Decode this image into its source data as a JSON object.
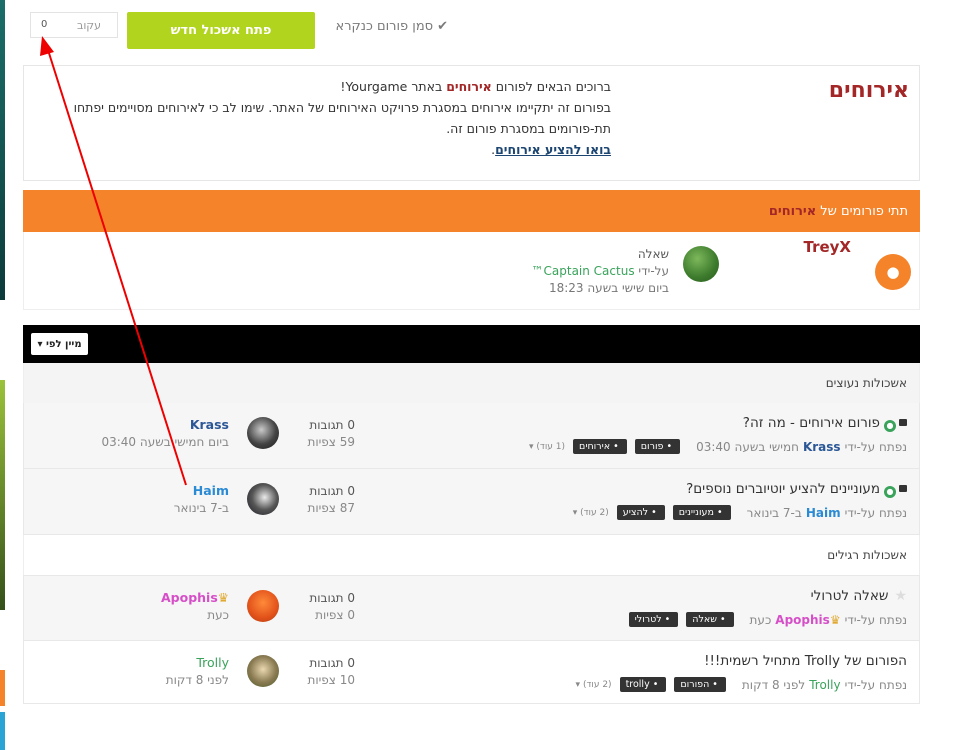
{
  "toolbar_top": {
    "follow_label": "עקוב",
    "follow_count": "0",
    "new_topic_label": "פתח אשכול חדש",
    "mark_read_label": "סמן פורום כנקרא"
  },
  "forum": {
    "title": "אירוחים",
    "welcome_prefix": "ברוכים הבאים לפורום",
    "welcome_name": "אירוחים",
    "welcome_suffix": "באתר Yourgame!",
    "description": "בפורום זה יתקיימו אירוחים במסגרת פרויקט האירוחים של האתר. שימו לב כי לאירוחים מסויימים יפתחו תת-פורומים במסגרת פורום זה.",
    "link_text": "בואו להציע אירוחים"
  },
  "subforums": {
    "header_prefix": "תתי פורומים של",
    "header_name": "אירוחים",
    "item": {
      "name": "TreyX",
      "last_topic": "שאלה",
      "by_prefix": "על-ידי",
      "last_user": "Captain Cactus™",
      "last_time": "ביום שישי בשעה 18:23"
    }
  },
  "list": {
    "sort_label": "מיין לפי"
  },
  "sections": {
    "pinned_label": "אשכולות נעוצים",
    "regular_label": "אשכולות רגילים"
  },
  "topics": [
    {
      "title": "פורום אירוחים - מה זה?",
      "meta_prefix": "נפתח על-ידי",
      "author": "Krass",
      "meta_time": "חמישי בשעה 03:40",
      "tags": [
        "פורום",
        "אירוחים"
      ],
      "more": "(1 עוד)",
      "replies": "0 תגובות",
      "views": "59 צפיות",
      "last_user": "Krass",
      "last_time": "ביום חמישי בשעה 03:40"
    },
    {
      "title": "מעוניינים להציע יוטיוברים נוספים?",
      "meta_prefix": "נפתח על-ידי",
      "author": "Haim",
      "meta_time": "ב-7 בינואר",
      "tags": [
        "מעוניינים",
        "להציע"
      ],
      "more": "(2 עוד)",
      "replies": "0 תגובות",
      "views": "87 צפיות",
      "last_user": "Haim",
      "last_time": "ב-7 בינואר"
    },
    {
      "title": "שאלה לטרולי",
      "meta_prefix": "נפתח על-ידי",
      "author": "Apophis",
      "meta_time": "כעת",
      "tags": [
        "שאלה",
        "לטרולי"
      ],
      "more": "",
      "replies": "0 תגובות",
      "views": "0 צפיות",
      "last_user": "Apophis",
      "last_time": "כעת"
    },
    {
      "title": "הפורום של Trolly מתחיל רשמית!!!",
      "meta_prefix": "נפתח על-ידי",
      "author": "Trolly",
      "meta_time": "לפני 8 דקות",
      "tags": [
        "הפורום",
        "trolly"
      ],
      "more": "(2 עוד)",
      "replies": "0 תגובות",
      "views": "10 צפיות",
      "last_user": "Trolly",
      "last_time": "לפני 8 דקות"
    }
  ],
  "colors": {
    "accent_orange": "#f5832a",
    "accent_green": "#b1d51e",
    "title_red": "#a32727",
    "annotation_arrow": "#ee0000"
  }
}
